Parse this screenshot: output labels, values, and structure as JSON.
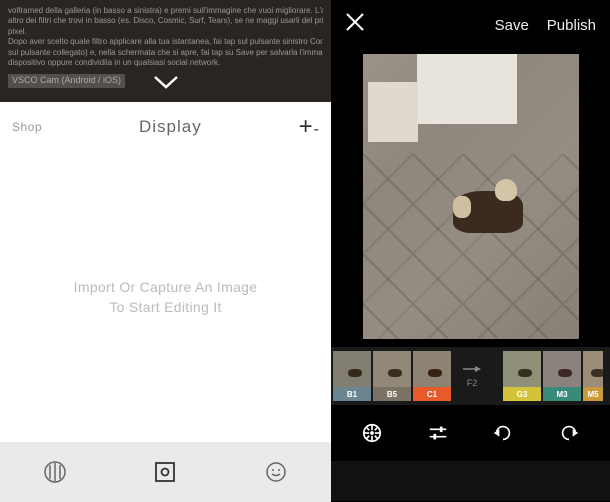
{
  "left": {
    "doc_lines": [
      "volframed della galleria (in basso a sinistra) e premi sull'immagine che vuoi migliorare. L'app verrà tutto un",
      "altro dei filtri che trovi in basso (es. Disco, Cosmic, Surf, Tears), se ne maggi usarli del primo",
      "pixel.",
      "Dopo aver scelto quale filtro applicare alla tua istantanea, fai tap sul pulsante sinistro Condividi (il terzo",
      "sul pulsante collegato) e, nella schermata che si apre, fai tap su Save per salvarla l'immagine sul tuo",
      "dispositivo oppure condividila in un qualsiasi social network."
    ],
    "vsco_label": "VSCO Cam (Android / iOS)",
    "header": {
      "shop": "Shop",
      "center": "Display",
      "add": "+"
    },
    "empty": {
      "line1": "Import Or Capture An Image",
      "line2": "To Start Editing It"
    }
  },
  "right": {
    "header": {
      "save": "Save",
      "publish": "Publish"
    },
    "filters": [
      {
        "label": "B1",
        "color": "#6b8590"
      },
      {
        "label": "B5",
        "color": "#7a7265"
      },
      {
        "label": "C1",
        "color": "#e85a2a"
      },
      {
        "label": "F2",
        "divider": true
      },
      {
        "label": "G3",
        "color": "#d4c23a"
      },
      {
        "label": "M3",
        "color": "#3a8a7a"
      },
      {
        "label": "M5",
        "color": "#c99a3a"
      }
    ]
  }
}
